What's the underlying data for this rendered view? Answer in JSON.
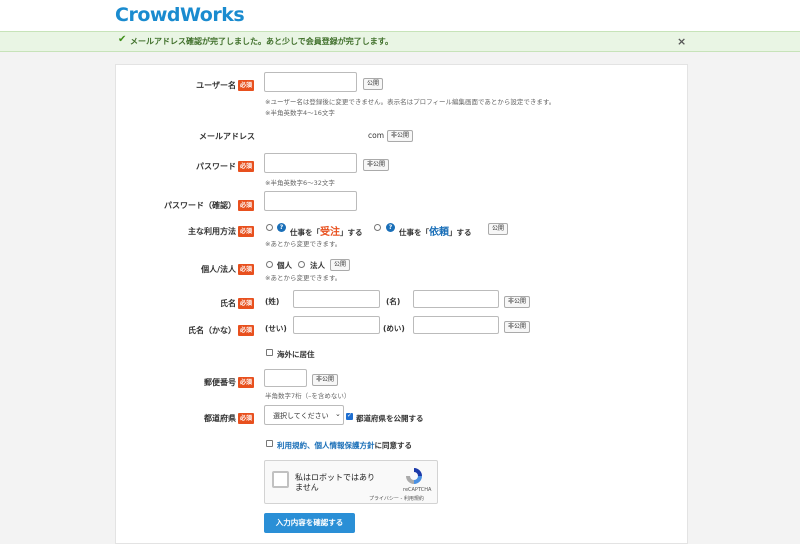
{
  "header": {
    "logo": "CrowdWorks"
  },
  "alert": {
    "check": "✔",
    "text": "メールアドレス確認が完了しました。あと少しで会員登録が完了します。",
    "close": "×"
  },
  "required_badge": "必須",
  "form": {
    "username": {
      "label": "ユーザー名",
      "value": "",
      "visibility": "公開",
      "note1": "※ユーザー名は登録後に変更できません。表示名はプロフィール編集画面であとから設定できます。",
      "note2": "※半角英数字4〜16文字"
    },
    "email": {
      "label": "メールアドレス",
      "suffix": "com",
      "visibility": "非公開"
    },
    "password": {
      "label": "パスワード",
      "visibility": "非公開",
      "note": "※半角英数字6〜32文字"
    },
    "password_confirm": {
      "label": "パスワード（確認）"
    },
    "usage": {
      "label": "主な利用方法",
      "option1_pre": "仕事を「",
      "option1_em": "受注",
      "option1_post": "」する",
      "option2_pre": "仕事を「",
      "option2_em": "依頼",
      "option2_post": "」する",
      "visibility": "公開",
      "note": "※あとから変更できます。",
      "q": "?"
    },
    "entity": {
      "label": "個人/法人",
      "option1": "個人",
      "option2": "法人",
      "visibility": "公開",
      "note": "※あとから変更できます。"
    },
    "name": {
      "label": "氏名",
      "last": "(姓)",
      "first": "(名)",
      "visibility": "非公開"
    },
    "name_kana": {
      "label": "氏名（かな）",
      "last": "(せい)",
      "first": "(めい)",
      "visibility": "非公開"
    },
    "overseas": {
      "label": "海外に居住"
    },
    "postal": {
      "label": "郵便番号",
      "visibility": "非公開",
      "note": "半角数字7桁（–を含めない）"
    },
    "prefecture": {
      "label": "都道府県",
      "selected": "選択してください",
      "publish_label": "都道府県を公開する"
    },
    "terms": {
      "link": "利用規約、個人情報保護方針",
      "suffix": "に同意する"
    },
    "captcha": {
      "text_line1": "私はロボットではあり",
      "text_line2": "ません",
      "brand": "reCAPTCHA",
      "links": "プライバシー - 利用規約"
    },
    "submit": "入力内容を確認する"
  },
  "colors": {
    "accent": "#1a8bcf",
    "required": "#e8501e",
    "success_bg": "#e9f5e4",
    "button": "#2a8fd6"
  }
}
